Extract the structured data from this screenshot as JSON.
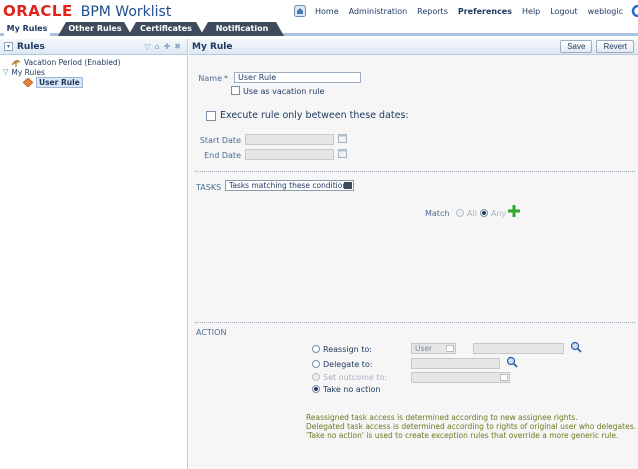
{
  "app": {
    "logo_brand": "ORACLE",
    "logo_product": "BPM Worklist"
  },
  "toplinks": [
    "Home",
    "Administration",
    "Reports",
    "Preferences",
    "Help",
    "Logout",
    "weblogic"
  ],
  "tabs": [
    {
      "label": "My Rules"
    },
    {
      "label": "Other Rules"
    },
    {
      "label": "Certificates"
    },
    {
      "label": "Notification"
    }
  ],
  "left": {
    "title": "Rules",
    "tree": [
      {
        "label": "Vacation Period (Enabled)"
      },
      {
        "label": "My Rules"
      },
      {
        "label": "User Rule"
      }
    ]
  },
  "main": {
    "title": "My Rule",
    "save_label": "Save",
    "revert_label": "Revert",
    "name_label": "Name",
    "name_required": "*",
    "name_value": "User Rule",
    "vacation_rule_label": "Use as vacation rule",
    "execute_dates_label": "Execute rule only between these dates:",
    "start_date_label": "Start Date",
    "end_date_label": "End Date",
    "tasks_label": "TASKS",
    "tasks_select_value": "Tasks matching these conditions",
    "match_label": "Match",
    "match_all": "All",
    "match_any": "Any",
    "action_label": "ACTION",
    "reassign_label": "Reassign to:",
    "reassign_type_value": "User",
    "delegate_label": "Delegate to:",
    "set_outcome_label": "Set outcome to:",
    "no_action_label": "Take no action",
    "notes": [
      "Reassigned task access is determined according to new assignee rights.",
      "Delegated task access is determined according to rights of original user who delegates.",
      "'Take no action' is used to create exception rules that override a more generic rule."
    ]
  },
  "colors": {
    "brand_red": "#e2231a",
    "product_blue": "#1e4d8f",
    "tab_dark": "#3d4b5c",
    "note_olive": "#6c7a1f",
    "add_green": "#2fa82f"
  }
}
